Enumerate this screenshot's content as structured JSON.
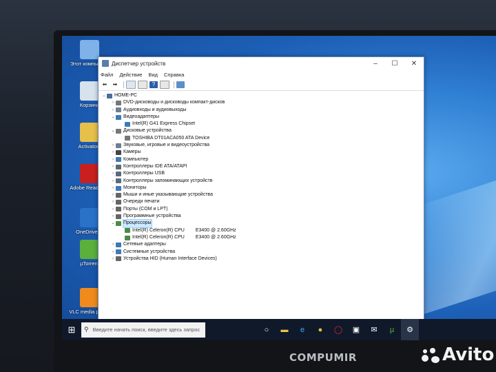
{
  "window": {
    "title": "Диспетчер устройств",
    "menu": [
      "Файл",
      "Действие",
      "Вид",
      "Справка"
    ]
  },
  "tree": [
    {
      "level": 0,
      "exp": "⌄",
      "label": "HOME-PC",
      "icon": "computer-icon",
      "color": "#4a6e9a"
    },
    {
      "level": 1,
      "exp": "›",
      "label": "DVD-дисководы и дисководы компакт-дисков",
      "icon": "dvd-drive-icon",
      "color": "#777"
    },
    {
      "level": 1,
      "exp": "›",
      "label": "Аудиовходы и аудиовыходы",
      "icon": "audio-icon",
      "color": "#6d7f93"
    },
    {
      "level": 1,
      "exp": "⌄",
      "label": "Видеоадаптеры",
      "icon": "display-adapter-icon",
      "color": "#3d7ab8"
    },
    {
      "level": 2,
      "exp": "",
      "label": "Intel(R) G41 Express Chipset",
      "icon": "display-adapter-icon",
      "color": "#3d7ab8"
    },
    {
      "level": 1,
      "exp": "⌄",
      "label": "Дисковые устройства",
      "icon": "disk-drive-icon",
      "color": "#777"
    },
    {
      "level": 2,
      "exp": "",
      "label": "TOSHIBA DT01ACA050 ATA Device",
      "icon": "disk-drive-icon",
      "color": "#777"
    },
    {
      "level": 1,
      "exp": "›",
      "label": "Звуковые, игровые и видеоустройства",
      "icon": "sound-icon",
      "color": "#6d7f93"
    },
    {
      "level": 1,
      "exp": "›",
      "label": "Камеры",
      "icon": "camera-icon",
      "color": "#444"
    },
    {
      "level": 1,
      "exp": "›",
      "label": "Компьютер",
      "icon": "computer-icon",
      "color": "#3d7ab8"
    },
    {
      "level": 1,
      "exp": "›",
      "label": "Контроллеры IDE ATA/ATAPI",
      "icon": "ide-controller-icon",
      "color": "#5b6b7d"
    },
    {
      "level": 1,
      "exp": "›",
      "label": "Контроллеры USB",
      "icon": "usb-controller-icon",
      "color": "#5b6b7d"
    },
    {
      "level": 1,
      "exp": "›",
      "label": "Контроллеры запоминающих устройств",
      "icon": "storage-controller-icon",
      "color": "#5b6b7d"
    },
    {
      "level": 1,
      "exp": "›",
      "label": "Мониторы",
      "icon": "monitor-icon",
      "color": "#3d7ab8"
    },
    {
      "level": 1,
      "exp": "›",
      "label": "Мыши и иные указывающие устройства",
      "icon": "mouse-icon",
      "color": "#666"
    },
    {
      "level": 1,
      "exp": "›",
      "label": "Очереди печати",
      "icon": "printer-icon",
      "color": "#666"
    },
    {
      "level": 1,
      "exp": "›",
      "label": "Порты (COM и LPT)",
      "icon": "port-icon",
      "color": "#666"
    },
    {
      "level": 1,
      "exp": "›",
      "label": "Программные устройства",
      "icon": "software-device-icon",
      "color": "#666"
    },
    {
      "level": 1,
      "exp": "⌄",
      "label": "Процессоры",
      "icon": "processor-icon",
      "color": "#4c8a4c",
      "selected": true
    },
    {
      "level": 2,
      "exp": "",
      "label": "Intel(R) Celeron(R) CPU",
      "extra": "E3400  @ 2.60GHz",
      "icon": "processor-icon",
      "color": "#4c8a4c"
    },
    {
      "level": 2,
      "exp": "",
      "label": "Intel(R) Celeron(R) CPU",
      "extra": "E3400  @ 2.60GHz",
      "icon": "processor-icon",
      "color": "#4c8a4c"
    },
    {
      "level": 1,
      "exp": "›",
      "label": "Сетевые адаптеры",
      "icon": "network-adapter-icon",
      "color": "#3d7ab8"
    },
    {
      "level": 1,
      "exp": "›",
      "label": "Системные устройства",
      "icon": "system-device-icon",
      "color": "#3d7ab8"
    },
    {
      "level": 1,
      "exp": "›",
      "label": "Устройства HID (Human Interface Devices)",
      "icon": "hid-icon",
      "color": "#666"
    }
  ],
  "desktop_icons": [
    {
      "label": "Этот компьютер",
      "icon": "this-pc-icon",
      "color": "#7fb2e8"
    },
    {
      "label": "Корзина",
      "icon": "recycle-bin-icon",
      "color": "#d8e2ec"
    },
    {
      "label": "Activators",
      "icon": "folder-icon",
      "color": "#e6c04a"
    },
    {
      "label": "Adobe Reader XI",
      "icon": "adobe-reader-icon",
      "color": "#c8201e"
    },
    {
      "label": "OneDrive ...",
      "icon": "onedrive-icon",
      "color": "#2a72c8"
    },
    {
      "label": "µTorrent",
      "icon": "utorrent-icon",
      "color": "#5ab03a"
    },
    {
      "label": "VLC media player",
      "icon": "vlc-icon",
      "color": "#f08a1c"
    }
  ],
  "taskbar": {
    "search_placeholder": "Введите начать поиск, введите здесь запрос"
  },
  "bezel": {
    "brand": "COMPUMIR",
    "watermark": "Avito"
  }
}
